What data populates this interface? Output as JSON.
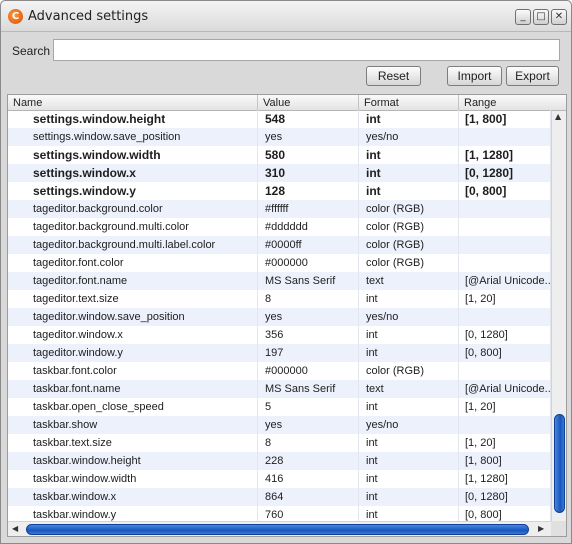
{
  "window": {
    "title": "Advanced settings",
    "app_icon_glyph": "C",
    "controls": {
      "minimize": "_",
      "maximize": "□",
      "close": "✕"
    }
  },
  "search": {
    "label": "Search",
    "value": "",
    "placeholder": ""
  },
  "toolbar": {
    "reset_label": "Reset",
    "import_label": "Import",
    "export_label": "Export"
  },
  "table": {
    "columns": [
      "Name",
      "Value",
      "Format",
      "Range"
    ],
    "rows": [
      {
        "name": "settings.window.height",
        "value": "548",
        "format": "int",
        "range": "[1, 800]",
        "bold": true
      },
      {
        "name": "settings.window.save_position",
        "value": "yes",
        "format": "yes/no",
        "range": "",
        "bold": false
      },
      {
        "name": "settings.window.width",
        "value": "580",
        "format": "int",
        "range": "[1, 1280]",
        "bold": true
      },
      {
        "name": "settings.window.x",
        "value": "310",
        "format": "int",
        "range": "[0, 1280]",
        "bold": true
      },
      {
        "name": "settings.window.y",
        "value": "128",
        "format": "int",
        "range": "[0, 800]",
        "bold": true
      },
      {
        "name": "tageditor.background.color",
        "value": "#ffffff",
        "format": "color (RGB)",
        "range": "",
        "bold": false
      },
      {
        "name": "tageditor.background.multi.color",
        "value": "#dddddd",
        "format": "color (RGB)",
        "range": "",
        "bold": false
      },
      {
        "name": "tageditor.background.multi.label.color",
        "value": "#0000ff",
        "format": "color (RGB)",
        "range": "",
        "bold": false
      },
      {
        "name": "tageditor.font.color",
        "value": "#000000",
        "format": "color (RGB)",
        "range": "",
        "bold": false
      },
      {
        "name": "tageditor.font.name",
        "value": "MS Sans Serif",
        "format": "text",
        "range": "[@Arial Unicode...",
        "bold": false
      },
      {
        "name": "tageditor.text.size",
        "value": "8",
        "format": "int",
        "range": "[1, 20]",
        "bold": false
      },
      {
        "name": "tageditor.window.save_position",
        "value": "yes",
        "format": "yes/no",
        "range": "",
        "bold": false
      },
      {
        "name": "tageditor.window.x",
        "value": "356",
        "format": "int",
        "range": "[0, 1280]",
        "bold": false
      },
      {
        "name": "tageditor.window.y",
        "value": "197",
        "format": "int",
        "range": "[0, 800]",
        "bold": false
      },
      {
        "name": "taskbar.font.color",
        "value": "#000000",
        "format": "color (RGB)",
        "range": "",
        "bold": false
      },
      {
        "name": "taskbar.font.name",
        "value": "MS Sans Serif",
        "format": "text",
        "range": "[@Arial Unicode...",
        "bold": false
      },
      {
        "name": "taskbar.open_close_speed",
        "value": "5",
        "format": "int",
        "range": "[1, 20]",
        "bold": false
      },
      {
        "name": "taskbar.show",
        "value": "yes",
        "format": "yes/no",
        "range": "",
        "bold": false
      },
      {
        "name": "taskbar.text.size",
        "value": "8",
        "format": "int",
        "range": "[1, 20]",
        "bold": false
      },
      {
        "name": "taskbar.window.height",
        "value": "228",
        "format": "int",
        "range": "[1, 800]",
        "bold": false
      },
      {
        "name": "taskbar.window.width",
        "value": "416",
        "format": "int",
        "range": "[1, 1280]",
        "bold": false
      },
      {
        "name": "taskbar.window.x",
        "value": "864",
        "format": "int",
        "range": "[0, 1280]",
        "bold": false
      },
      {
        "name": "taskbar.window.y",
        "value": "760",
        "format": "int",
        "range": "[0, 800]",
        "bold": false
      }
    ]
  },
  "scrollbars": {
    "vertical_thumb_color": "#1656c0",
    "arrow_up": "▲",
    "arrow_down": "▼",
    "arrow_left": "◀",
    "arrow_right": "▶"
  }
}
